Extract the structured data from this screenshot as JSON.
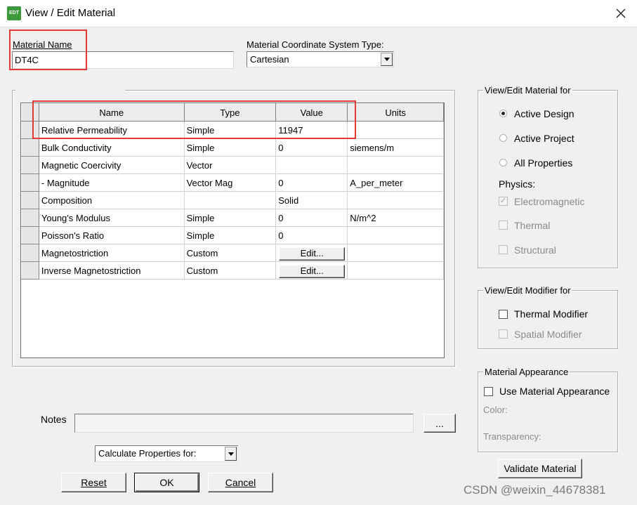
{
  "window": {
    "title": "View / Edit Material",
    "icon_text": "EDT",
    "close_glyph": "✕"
  },
  "material_name": {
    "label": "Material Name",
    "value": "DT4C"
  },
  "coord_system": {
    "label": "Material Coordinate System Type:",
    "value": "Cartesian"
  },
  "table": {
    "headers": [
      "Name",
      "Type",
      "Value",
      "Units"
    ],
    "rows": [
      {
        "name": "Relative Permeability",
        "type": "Simple",
        "value": "11947",
        "units": ""
      },
      {
        "name": "Bulk Conductivity",
        "type": "Simple",
        "value": "0",
        "units": "siemens/m"
      },
      {
        "name": "Magnetic Coercivity",
        "type": "Vector",
        "value": "",
        "units": ""
      },
      {
        "name": "-  Magnitude",
        "type": "Vector Mag",
        "value": "0",
        "units": "A_per_meter"
      },
      {
        "name": "Composition",
        "type": "",
        "value": "Solid",
        "units": ""
      },
      {
        "name": "Young's Modulus",
        "type": "Simple",
        "value": "0",
        "units": "N/m^2"
      },
      {
        "name": "Poisson's Ratio",
        "type": "Simple",
        "value": "0",
        "units": ""
      },
      {
        "name": "Magnetostriction",
        "type": "Custom",
        "value": "Edit...",
        "units": ""
      },
      {
        "name": "Inverse Magnetostriction",
        "type": "Custom",
        "value": "Edit...",
        "units": ""
      }
    ]
  },
  "view_edit_for": {
    "title": "View/Edit Material for",
    "options": [
      "Active Design",
      "Active Project",
      "All Properties"
    ],
    "selected": "Active Design",
    "physics_label": "Physics:",
    "physics": [
      {
        "label": "Electromagnetic",
        "checked": true
      },
      {
        "label": "Thermal",
        "checked": false
      },
      {
        "label": "Structural",
        "checked": false
      }
    ]
  },
  "modifier_for": {
    "title": "View/Edit Modifier for",
    "thermal_label": "Thermal Modifier",
    "spatial_label": "Spatial Modifier"
  },
  "appearance": {
    "title": "Material Appearance",
    "use_label": "Use Material Appearance",
    "color_label": "Color:",
    "transparency_label": "Transparency:"
  },
  "validate_label": "Validate Material",
  "notes": {
    "label": "Notes",
    "value": "",
    "browse_label": "..."
  },
  "calc_props": {
    "value": "Calculate Properties for:"
  },
  "buttons": {
    "reset": "Reset",
    "ok": "OK",
    "cancel": "Cancel"
  },
  "watermark": "CSDN @weixin_44678381",
  "colors": {
    "highlight_box": "#e53935",
    "dialog_bg": "#f0f0f0"
  }
}
